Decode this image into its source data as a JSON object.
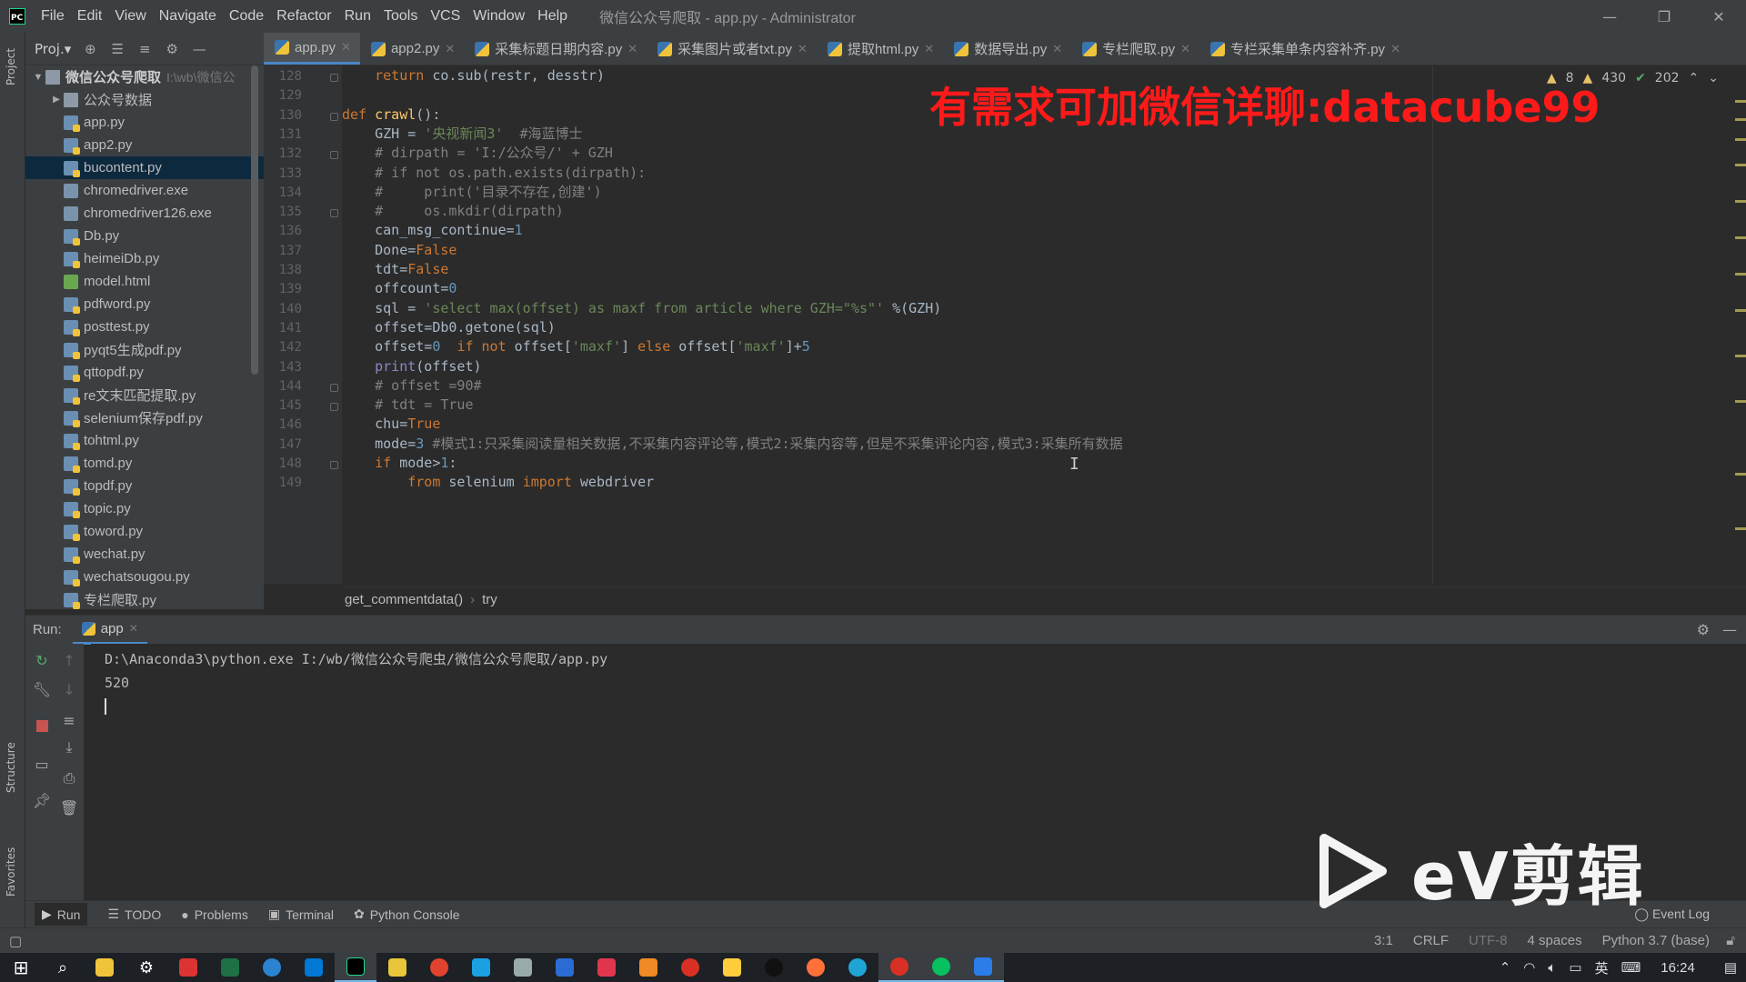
{
  "titlebar": {
    "menu": [
      "File",
      "Edit",
      "View",
      "Navigate",
      "Code",
      "Refactor",
      "Run",
      "Tools",
      "VCS",
      "Window",
      "Help"
    ],
    "title": "微信公众号爬取 - app.py - Administrator",
    "minimize": "—",
    "restore": "❐",
    "close": "✕"
  },
  "left_strip": {
    "project": "Project",
    "structure": "Structure",
    "favorites": "Favorites"
  },
  "project_panel": {
    "header": "Proj.▾",
    "root": {
      "name": "微信公众号爬取",
      "path": "I:\\wb\\微信公"
    },
    "items": [
      {
        "name": "公众号数据",
        "type": "folder"
      },
      {
        "name": "app.py",
        "type": "py"
      },
      {
        "name": "app2.py",
        "type": "py"
      },
      {
        "name": "bucontent.py",
        "type": "py",
        "selected": true
      },
      {
        "name": "chromedriver.exe",
        "type": "exe"
      },
      {
        "name": "chromedriver126.exe",
        "type": "exe"
      },
      {
        "name": "Db.py",
        "type": "py"
      },
      {
        "name": "heimeiDb.py",
        "type": "py"
      },
      {
        "name": "model.html",
        "type": "html"
      },
      {
        "name": "pdfword.py",
        "type": "py"
      },
      {
        "name": "posttest.py",
        "type": "py"
      },
      {
        "name": "pyqt5生成pdf.py",
        "type": "py"
      },
      {
        "name": "qttopdf.py",
        "type": "py"
      },
      {
        "name": "re文末匹配提取.py",
        "type": "py"
      },
      {
        "name": "selenium保存pdf.py",
        "type": "py"
      },
      {
        "name": "tohtml.py",
        "type": "py"
      },
      {
        "name": "tomd.py",
        "type": "py"
      },
      {
        "name": "topdf.py",
        "type": "py"
      },
      {
        "name": "topic.py",
        "type": "py"
      },
      {
        "name": "toword.py",
        "type": "py"
      },
      {
        "name": "wechat.py",
        "type": "py"
      },
      {
        "name": "wechatsougou.py",
        "type": "py"
      },
      {
        "name": "专栏爬取.py",
        "type": "py"
      }
    ]
  },
  "tabs": [
    {
      "label": "app.py",
      "active": true
    },
    {
      "label": "app2.py"
    },
    {
      "label": "采集标题日期内容.py"
    },
    {
      "label": "采集图片或者txt.py"
    },
    {
      "label": "提取html.py"
    },
    {
      "label": "数据导出.py"
    },
    {
      "label": "专栏爬取.py"
    },
    {
      "label": "专栏采集单条内容补齐.py"
    }
  ],
  "inspections": {
    "warnings": "8",
    "weak_warnings": "430",
    "ok": "202"
  },
  "overlay": "有需求可加微信详聊:datacube99",
  "editor": {
    "line_numbers": [
      "128",
      "129",
      "130",
      "131",
      "132",
      "133",
      "134",
      "135",
      "136",
      "137",
      "138",
      "139",
      "140",
      "141",
      "142",
      "143",
      "144",
      "145",
      "146",
      "147",
      "148",
      "149"
    ],
    "code": [
      "    return co.sub(restr, desstr)",
      "",
      "def crawl():",
      "    GZH = '央视新闻3'  #海蓝博士",
      "    # dirpath = 'I:/公众号/' + GZH",
      "    # if not os.path.exists(dirpath):",
      "    #     print('目录不存在,创建')",
      "    #     os.mkdir(dirpath)",
      "    can_msg_continue=1",
      "    Done=False",
      "    tdt=False",
      "    offcount=0",
      "    sql = 'select max(offset) as maxf from article where GZH=\"%s\"' %(GZH)",
      "    offset=Db0.getone(sql)",
      "    offset=0  if not offset['maxf'] else offset['maxf']+5",
      "    print(offset)",
      "    # offset =90#",
      "    # tdt = True",
      "    chu=True",
      "    mode=3 #模式1:只采集阅读量相关数据,不采集内容评论等,模式2:采集内容等,但是不采集评论内容,模式3:采集所有数据",
      "    if mode>1:",
      "        from selenium import webdriver"
    ]
  },
  "breadcrumb": [
    "get_commentdata()",
    "try"
  ],
  "run_panel": {
    "label": "Run:",
    "tab": "app",
    "console": [
      "D:\\Anaconda3\\python.exe I:/wb/微信公众号爬虫/微信公众号爬取/app.py",
      "520"
    ]
  },
  "tool_tabs": [
    "Run",
    "TODO",
    "Problems",
    "Terminal",
    "Python Console"
  ],
  "event_log": "Event Log",
  "status": {
    "position": "3:1",
    "line_sep": "CRLF",
    "encoding": "UTF-8",
    "indent": "4 spaces",
    "interpreter": "Python 3.7 (base)"
  },
  "taskbar": {
    "ime": "英",
    "time": "16:24"
  },
  "watermark": {
    "text": "eV剪辑"
  }
}
